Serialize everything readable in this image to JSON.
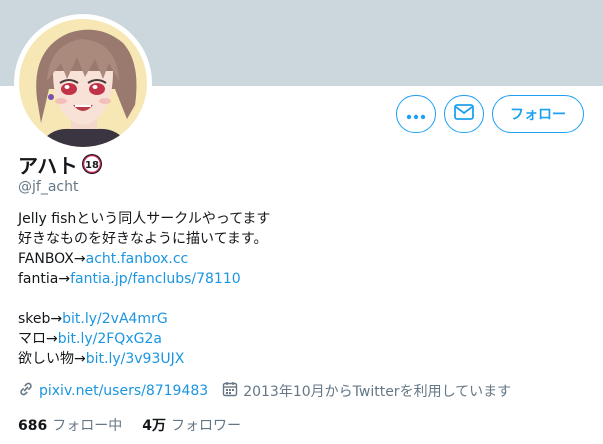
{
  "profile": {
    "display_name": "アハト",
    "badge_text": "18",
    "handle": "@jf_acht"
  },
  "actions": {
    "more_icon": "more-horizontal-icon",
    "mail_icon": "envelope-icon",
    "follow_label": "フォロー"
  },
  "bio": {
    "line1": "Jelly fishという同人サークルやってます",
    "line2": "好きなものを好きなように描いてます。",
    "fanbox_prefix": "FANBOX→",
    "fanbox_link": "acht.fanbox.cc",
    "fantia_prefix": "fantia→",
    "fantia_link": "fantia.jp/fanclubs/78110",
    "skeb_prefix": "skeb→",
    "skeb_link": "bit.ly/2vA4mrG",
    "maro_prefix": "マロ→",
    "maro_link": "bit.ly/2FQxG2a",
    "wishlist_prefix": "欲しい物→",
    "wishlist_link": "bit.ly/3v93UJX"
  },
  "meta": {
    "website": "pixiv.net/users/8719483",
    "joined": "2013年10月からTwitterを利用しています"
  },
  "stats": {
    "following_count": "686",
    "following_label": "フォロー中",
    "followers_count": "4万",
    "followers_label": "フォロワー"
  },
  "colors": {
    "accent": "#1da1f2",
    "link": "#1b95e0",
    "banner": "#ccd6dd",
    "secondary_text": "#657786",
    "badge": "#e0245e"
  }
}
